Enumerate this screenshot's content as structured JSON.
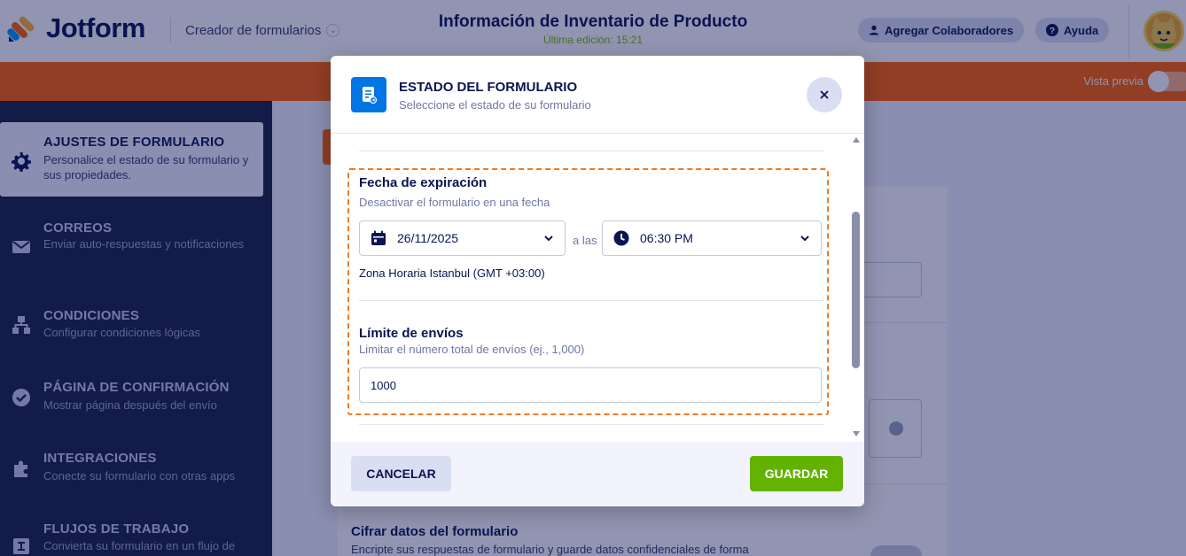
{
  "app": {
    "logo_text": "Jotform",
    "builder_label": "Creador de formularios",
    "form_title": "Información de Inventario de Producto",
    "last_edit": "Última edición: 15:21",
    "collaborators_label": "Agregar Colaboradores",
    "help_label": "Ayuda",
    "preview_label": "Vista previa"
  },
  "sidebar": {
    "items": [
      {
        "title": "AJUSTES DE FORMULARIO",
        "desc": "Personalice el estado de su formulario y sus propiedades."
      },
      {
        "title": "CORREOS",
        "desc": "Enviar auto-respuestas y notificaciones"
      },
      {
        "title": "CONDICIONES",
        "desc": "Configurar condiciones lógicas"
      },
      {
        "title": "PÁGINA DE CONFIRMACIÓN",
        "desc": "Mostrar página después del envío"
      },
      {
        "title": "INTEGRACIONES",
        "desc": "Conecte su formulario con otras apps"
      },
      {
        "title": "FLUJOS DE TRABAJO",
        "desc": "Convierta su formulario en un flujo de"
      }
    ]
  },
  "background": {
    "encrypt_title": "Cifrar datos del formulario",
    "encrypt_desc": "Encripte sus respuestas de formulario y guarde datos confidenciales de forma"
  },
  "modal": {
    "title": "ESTADO DEL FORMULARIO",
    "subtitle": "Seleccione el estado de su formulario",
    "expiration": {
      "label": "Fecha de expiración",
      "desc": "Desactivar el formulario en una fecha",
      "date": "26/11/2025",
      "at_label": "a las",
      "time": "06:30 PM",
      "timezone": "Zona Horaria Istanbul (GMT +03:00)"
    },
    "limit": {
      "label": "Límite de envíos",
      "desc": "Limitar el número total de envíos (ej., 1,000)",
      "value": "1000"
    },
    "cancel_label": "CANCELAR",
    "save_label": "GUARDAR"
  },
  "colors": {
    "navy": "#0a1551",
    "orange": "#ff6100",
    "green": "#64b200",
    "blue": "#0075e3",
    "highlight": "#f07a1e"
  }
}
